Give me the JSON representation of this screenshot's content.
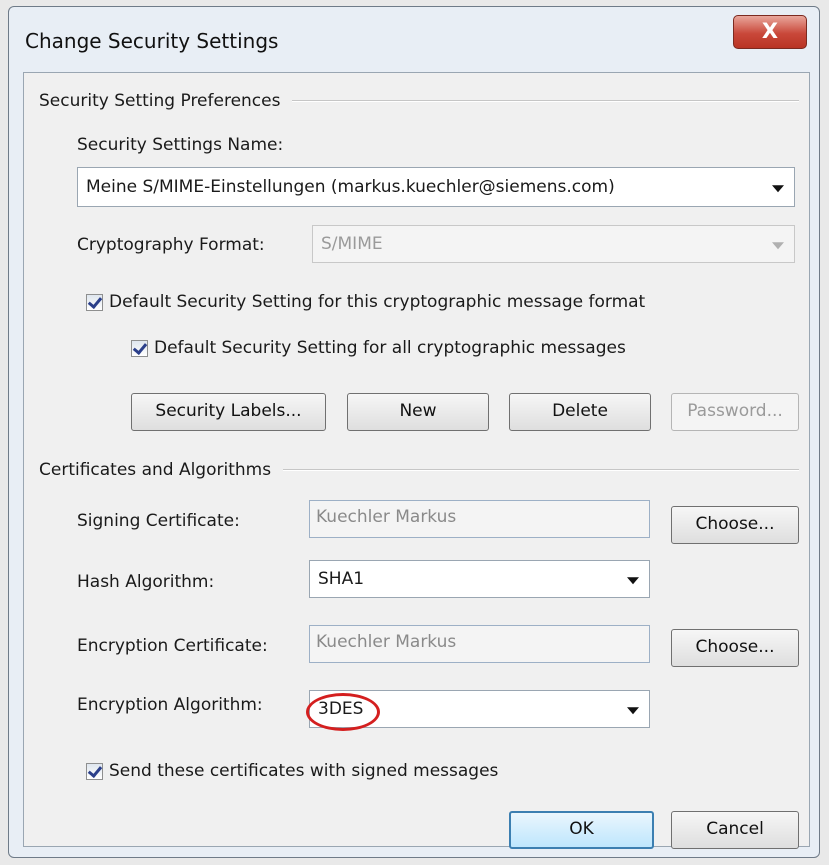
{
  "window": {
    "title": "Change Security Settings",
    "close_label": "X"
  },
  "preferences": {
    "group_label": "Security Setting Preferences",
    "name_label": "Security Settings Name:",
    "name_value": "Meine S/MIME-Einstellungen (markus.kuechler@siemens.com)",
    "format_label": "Cryptography Format:",
    "format_value": "S/MIME",
    "default_format_label": "Default Security Setting for this cryptographic message format",
    "default_format_checked": true,
    "default_all_label": "Default Security Setting for all cryptographic messages",
    "default_all_checked": true,
    "buttons": {
      "security_labels": "Security Labels...",
      "new": "New",
      "delete": "Delete",
      "password": "Password..."
    }
  },
  "certificates": {
    "group_label": "Certificates and Algorithms",
    "signing_label": "Signing Certificate:",
    "signing_value": "Kuechler Markus",
    "choose_label": "Choose...",
    "hash_label": "Hash Algorithm:",
    "hash_value": "SHA1",
    "encryption_cert_label": "Encryption Certificate:",
    "encryption_cert_value": "Kuechler Markus",
    "encryption_alg_label": "Encryption Algorithm:",
    "encryption_alg_value": "3DES",
    "send_certs_label": "Send these certificates with signed messages",
    "send_certs_checked": true
  },
  "footer": {
    "ok": "OK",
    "cancel": "Cancel"
  },
  "colors": {
    "highlight": "#d41f1f",
    "close_button": "#c9483a",
    "default_button_border": "#3c7fb1"
  }
}
